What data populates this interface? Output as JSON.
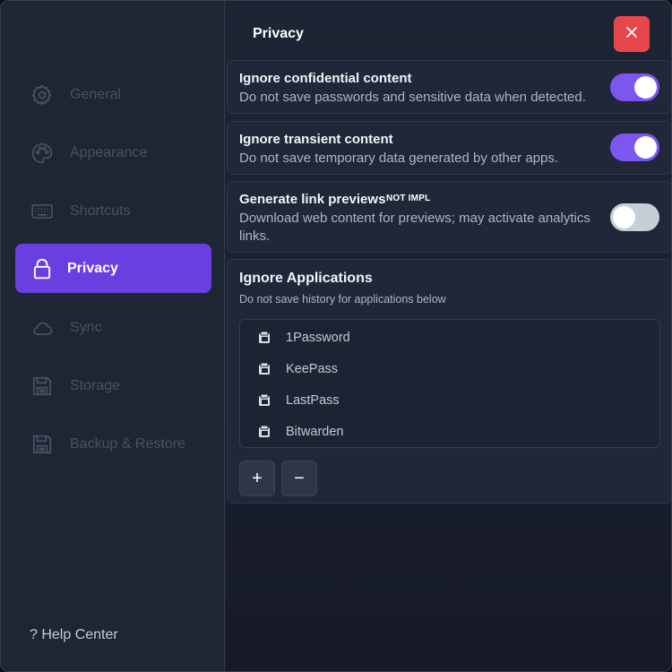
{
  "sidebar": {
    "items": [
      {
        "label": "General",
        "icon": "gear-icon"
      },
      {
        "label": "Appearance",
        "icon": "palette-icon"
      },
      {
        "label": "Shortcuts",
        "icon": "keyboard-icon"
      },
      {
        "label": "Privacy",
        "icon": "lock-icon",
        "active": true
      },
      {
        "label": "Sync",
        "icon": "cloud-icon"
      },
      {
        "label": "Storage",
        "icon": "save-icon"
      },
      {
        "label": "Backup & Restore",
        "icon": "backup-icon"
      }
    ],
    "help_label": "? Help Center"
  },
  "header": {
    "title": "Privacy"
  },
  "settings": {
    "confidential": {
      "title": "Ignore confidential content",
      "desc": "Do not save passwords and sensitive data when detected.",
      "enabled": true
    },
    "transient": {
      "title": "Ignore transient content",
      "desc": "Do not save temporary data generated by other apps.",
      "enabled": true
    },
    "link_previews": {
      "title": "Generate link previews",
      "badge": "NOT IMPL",
      "desc_line1": "Download web content for previews; may activate analytics",
      "desc_line2": "links.",
      "enabled": false
    }
  },
  "ignore_apps": {
    "title": "Ignore Applications",
    "desc": "Do not save history for applications below",
    "apps": [
      "1Password",
      "KeePass",
      "LastPass",
      "Bitwarden"
    ],
    "add_label": "+",
    "remove_label": "−"
  },
  "colors": {
    "accent": "#6a3fe0",
    "toggle_on": "#7b57f0",
    "close": "#e8474a",
    "background": "#1f2634"
  }
}
